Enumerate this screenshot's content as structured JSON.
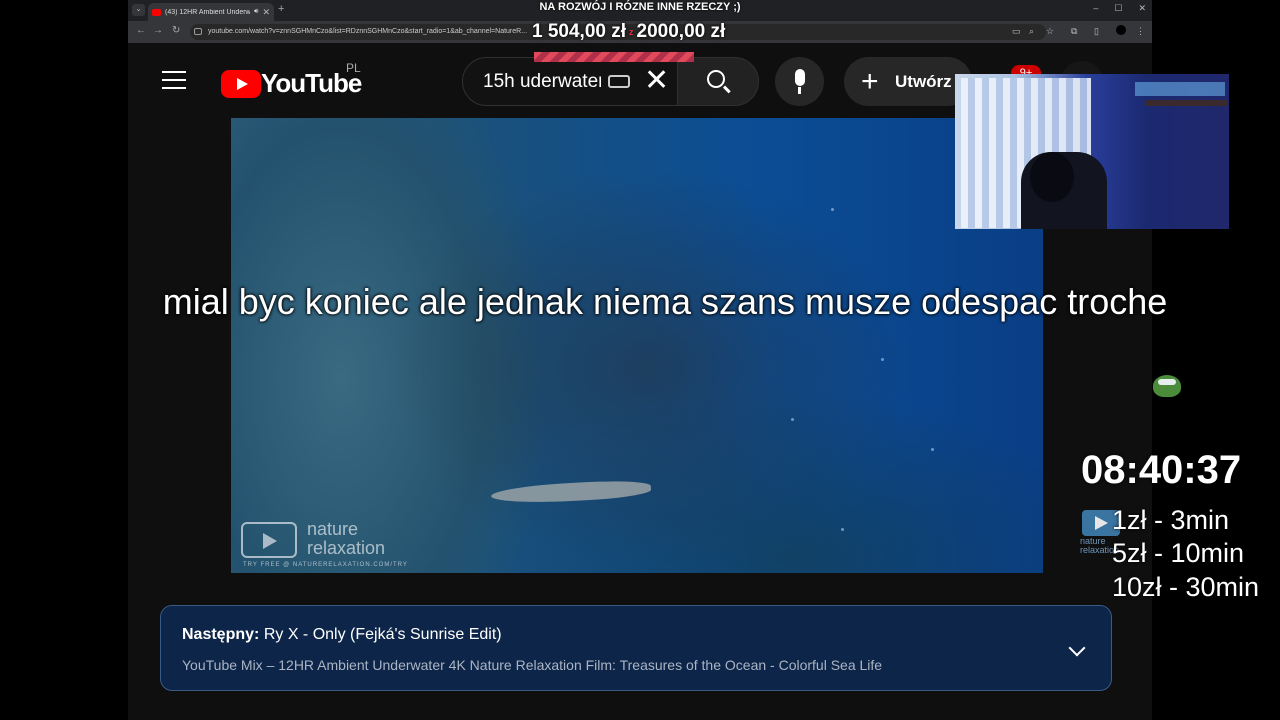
{
  "browser": {
    "tab_title": "(43) 12HR Ambient Underw...",
    "url": "youtube.com/watch?v=znnSGHMnCzo&list=RDznnSGHMnCzo&start_radio=1&ab_channel=NatureR..."
  },
  "youtube": {
    "logo_text": "YouTube",
    "region": "PL",
    "search_query": "15h uderwater",
    "create_label": "Utwórz",
    "notification_badge": "9+"
  },
  "video": {
    "watermark_line1": "nature",
    "watermark_line2": "relaxation",
    "watermark_line3": "TRY FREE @ NATURERELAXATION.COM/TRY"
  },
  "up_next": {
    "label": "Następny:",
    "title": "Ry X - Only (Fejká's Sunrise Edit)",
    "playlist": "YouTube Mix – 12HR Ambient Underwater 4K Nature Relaxation Film: Treasures of the Ocean - Colorful Sea Life"
  },
  "overlay": {
    "stream_title": "NA ROZWÓJ I RÓZNE INNE RZECZY ;)",
    "goal_current": "1 504,00 zł",
    "goal_separator": "z",
    "goal_target": "2000,00 zł",
    "goal_progress": 0.752,
    "message": "mial byc koniec ale jednak niema szans musze odespac troche",
    "timer": "08:40:37",
    "logo_line1": "nature",
    "logo_line2": "relaxation",
    "prices": [
      "1zł - 3min",
      "5zł - 10min",
      "10zł - 30min"
    ]
  },
  "colors": {
    "youtube_red": "#ff0000",
    "upnext_bg": "#0d2548",
    "goal_bar": "#e04a5a"
  },
  "icons": [
    "menu-icon",
    "keyboard-icon",
    "clear-icon",
    "search-icon",
    "mic-icon",
    "plus-icon",
    "bell-icon",
    "chevron-down-icon"
  ]
}
